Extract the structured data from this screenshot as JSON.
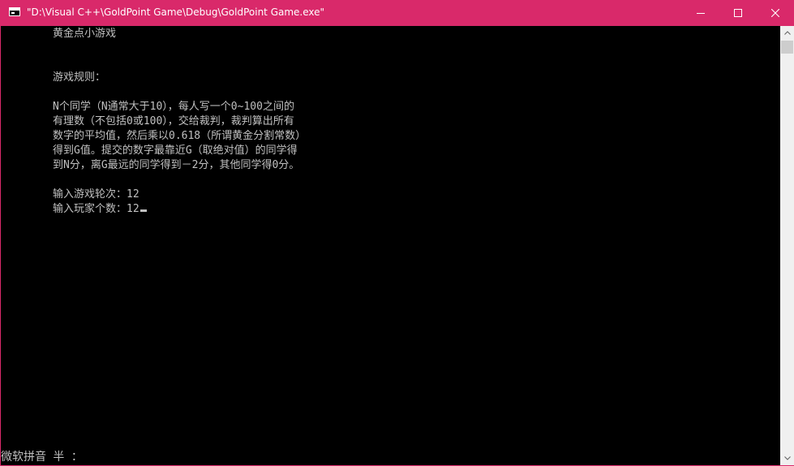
{
  "window": {
    "title": "\"D:\\Visual C++\\GoldPoint Game\\Debug\\GoldPoint Game.exe\"",
    "accent_color": "#d9296a",
    "controls": {
      "minimize_icon": "minimize-icon",
      "maximize_icon": "maximize-icon",
      "close_icon": "close-icon"
    }
  },
  "console": {
    "lines": [
      "黄金点小游戏",
      "",
      "",
      "游戏规则：",
      "",
      "N个同学（N通常大于10），每人写一个0~100之间的",
      "有理数（不包括0或100），交给裁判，裁判算出所有",
      "数字的平均值，然后乘以0.618（所谓黄金分割常数）",
      "得到G值。提交的数字最靠近G（取绝对值）的同学得",
      "到N分，离G最远的同学得到－2分，其他同学得0分。",
      "",
      "输入游戏轮次：12",
      "输入玩家个数：12"
    ],
    "ime_status": "微软拼音 半 ："
  },
  "colors": {
    "background": "#000000",
    "text": "#c0c0c0",
    "scrollbar_track": "#f0f0f0",
    "scrollbar_thumb": "#cdcdcd"
  }
}
